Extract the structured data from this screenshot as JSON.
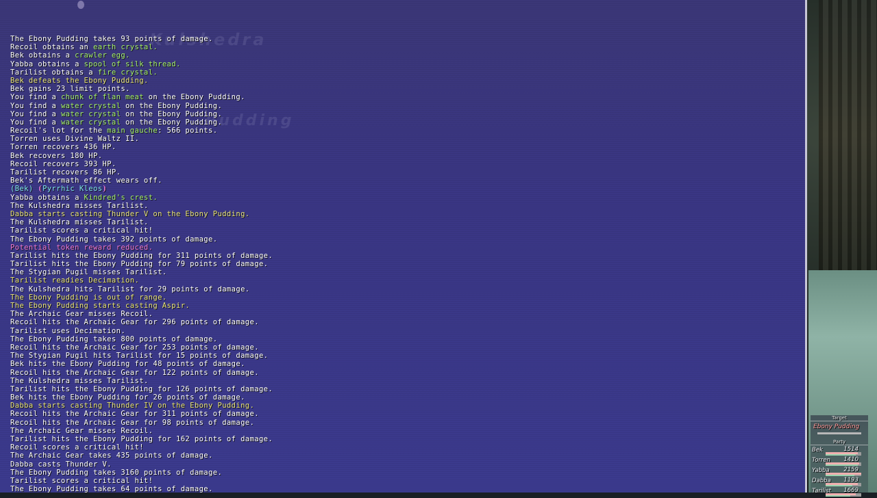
{
  "chat_log": {
    "lines": [
      {
        "segments": [
          {
            "t": "The Ebony Pudding takes 93 points of damage.",
            "c": "white"
          }
        ]
      },
      {
        "segments": [
          {
            "t": "Recoil obtains an ",
            "c": "white"
          },
          {
            "t": "earth crystal.",
            "c": "green"
          }
        ]
      },
      {
        "segments": [
          {
            "t": "Bek obtains a ",
            "c": "white"
          },
          {
            "t": "crawler egg.",
            "c": "green"
          }
        ]
      },
      {
        "segments": [
          {
            "t": "Yabba obtains a ",
            "c": "white"
          },
          {
            "t": "spool of silk thread.",
            "c": "green"
          }
        ]
      },
      {
        "segments": [
          {
            "t": "Tarilist obtains a ",
            "c": "white"
          },
          {
            "t": "fire crystal.",
            "c": "green"
          }
        ]
      },
      {
        "segments": [
          {
            "t": "Bek defeats the Ebony Pudding.",
            "c": "yellow"
          }
        ]
      },
      {
        "segments": [
          {
            "t": "Bek gains 23 limit points.",
            "c": "white"
          }
        ]
      },
      {
        "segments": [
          {
            "t": "You find a ",
            "c": "white"
          },
          {
            "t": "chunk of flan meat",
            "c": "green"
          },
          {
            "t": " on the Ebony Pudding.",
            "c": "white"
          }
        ]
      },
      {
        "segments": [
          {
            "t": "You find a ",
            "c": "white"
          },
          {
            "t": "water crystal",
            "c": "green"
          },
          {
            "t": " on the Ebony Pudding.",
            "c": "white"
          }
        ]
      },
      {
        "segments": [
          {
            "t": "You find a ",
            "c": "white"
          },
          {
            "t": "water crystal",
            "c": "green"
          },
          {
            "t": " on the Ebony Pudding.",
            "c": "white"
          }
        ]
      },
      {
        "segments": [
          {
            "t": "You find a ",
            "c": "white"
          },
          {
            "t": "water crystal",
            "c": "green"
          },
          {
            "t": " on the Ebony Pudding.",
            "c": "white"
          }
        ]
      },
      {
        "segments": [
          {
            "t": "Recoil's lot for the ",
            "c": "white"
          },
          {
            "t": "main gauche",
            "c": "green"
          },
          {
            "t": ": 566 points.",
            "c": "white"
          }
        ]
      },
      {
        "segments": [
          {
            "t": "Torren uses Divine Waltz II.",
            "c": "white"
          }
        ]
      },
      {
        "segments": [
          {
            "t": "Torren recovers 436 HP.",
            "c": "white"
          }
        ]
      },
      {
        "segments": [
          {
            "t": "Bek recovers 180 HP.",
            "c": "white"
          }
        ]
      },
      {
        "segments": [
          {
            "t": "Recoil recovers 393 HP.",
            "c": "white"
          }
        ]
      },
      {
        "segments": [
          {
            "t": "Tarilist recovers 86 HP.",
            "c": "white"
          }
        ]
      },
      {
        "segments": [
          {
            "t": "Bek's Aftermath effect wears off.",
            "c": "white"
          }
        ]
      },
      {
        "segments": [
          {
            "t": "(Bek) ",
            "c": "cyan"
          },
          {
            "t": "⦗",
            "c": "pink"
          },
          {
            "t": "Pyrrhic Kleos",
            "c": "cyan"
          },
          {
            "t": "⦘",
            "c": "pink"
          }
        ]
      },
      {
        "segments": [
          {
            "t": "Yabba obtains a ",
            "c": "white"
          },
          {
            "t": "Kindred's crest.",
            "c": "green"
          }
        ]
      },
      {
        "segments": [
          {
            "t": "The Kulshedra misses Tarilist.",
            "c": "white"
          }
        ]
      },
      {
        "segments": [
          {
            "t": "Dabba starts casting Thunder V on the Ebony Pudding.",
            "c": "yellow"
          }
        ]
      },
      {
        "segments": [
          {
            "t": "The Kulshedra misses Tarilist.",
            "c": "white"
          }
        ]
      },
      {
        "segments": [
          {
            "t": "Tarilist scores a critical hit!",
            "c": "white"
          }
        ]
      },
      {
        "segments": [
          {
            "t": "The Ebony Pudding takes 392 points of damage.",
            "c": "white"
          }
        ]
      },
      {
        "segments": [
          {
            "t": "Potential token reward reduced.",
            "c": "pink"
          }
        ]
      },
      {
        "segments": [
          {
            "t": "Tarilist hits the Ebony Pudding for 311 points of damage.",
            "c": "white"
          }
        ]
      },
      {
        "segments": [
          {
            "t": "Tarilist hits the Ebony Pudding for 79 points of damage.",
            "c": "white"
          }
        ]
      },
      {
        "segments": [
          {
            "t": "The Stygian Pugil misses Tarilist.",
            "c": "white"
          }
        ]
      },
      {
        "segments": [
          {
            "t": "Tarilist readies Decimation.",
            "c": "yellow"
          }
        ]
      },
      {
        "segments": [
          {
            "t": "The Kulshedra hits Tarilist for 29 points of damage.",
            "c": "white"
          }
        ]
      },
      {
        "segments": [
          {
            "t": "The Ebony Pudding is out of range.",
            "c": "yellow"
          }
        ]
      },
      {
        "segments": [
          {
            "t": "The Ebony Pudding starts casting Aspir.",
            "c": "yellow"
          }
        ]
      },
      {
        "segments": [
          {
            "t": "The Archaic Gear misses Recoil.",
            "c": "white"
          }
        ]
      },
      {
        "segments": [
          {
            "t": "Recoil hits the Archaic Gear for 296 points of damage.",
            "c": "white"
          }
        ]
      },
      {
        "segments": [
          {
            "t": "Tarilist uses Decimation.",
            "c": "white"
          }
        ]
      },
      {
        "segments": [
          {
            "t": "The Ebony Pudding takes 800 points of damage.",
            "c": "white"
          }
        ]
      },
      {
        "segments": [
          {
            "t": "Recoil hits the Archaic Gear for 253 points of damage.",
            "c": "white"
          }
        ]
      },
      {
        "segments": [
          {
            "t": "The Stygian Pugil hits Tarilist for 15 points of damage.",
            "c": "white"
          }
        ]
      },
      {
        "segments": [
          {
            "t": "Bek hits the Ebony Pudding for 48 points of damage.",
            "c": "white"
          }
        ]
      },
      {
        "segments": [
          {
            "t": "Recoil hits the Archaic Gear for 122 points of damage.",
            "c": "white"
          }
        ]
      },
      {
        "segments": [
          {
            "t": "The Kulshedra misses Tarilist.",
            "c": "white"
          }
        ]
      },
      {
        "segments": [
          {
            "t": "Tarilist hits the Ebony Pudding for 126 points of damage.",
            "c": "white"
          }
        ]
      },
      {
        "segments": [
          {
            "t": "Bek hits the Ebony Pudding for 26 points of damage.",
            "c": "white"
          }
        ]
      },
      {
        "segments": [
          {
            "t": "Dabba starts casting Thunder IV on the Ebony Pudding.",
            "c": "yellow"
          }
        ]
      },
      {
        "segments": [
          {
            "t": "Recoil hits the Archaic Gear for 311 points of damage.",
            "c": "white"
          }
        ]
      },
      {
        "segments": [
          {
            "t": "Recoil hits the Archaic Gear for 98 points of damage.",
            "c": "white"
          }
        ]
      },
      {
        "segments": [
          {
            "t": "The Archaic Gear misses Recoil.",
            "c": "white"
          }
        ]
      },
      {
        "segments": [
          {
            "t": "Tarilist hits the Ebony Pudding for 162 points of damage.",
            "c": "white"
          }
        ]
      },
      {
        "segments": [
          {
            "t": "Recoil scores a critical hit!",
            "c": "white"
          }
        ]
      },
      {
        "segments": [
          {
            "t": "The Archaic Gear takes 435 points of damage.",
            "c": "white"
          }
        ]
      },
      {
        "segments": [
          {
            "t": "Dabba casts Thunder V.",
            "c": "white"
          }
        ]
      },
      {
        "segments": [
          {
            "t": "The Ebony Pudding takes 3160 points of damage.",
            "c": "white"
          }
        ]
      },
      {
        "segments": [
          {
            "t": "Tarilist scores a critical hit!",
            "c": "white"
          }
        ]
      },
      {
        "segments": [
          {
            "t": "The Ebony Pudding takes 64 points of damage.",
            "c": "white"
          }
        ]
      }
    ],
    "background_text": [
      "Kulshedra",
      "Pudding"
    ]
  },
  "hud": {
    "target_label": "Target",
    "target_name": "Ebony Pudding",
    "party_label": "Party",
    "members": [
      {
        "name": "Bek",
        "hp": "1514",
        "hp_fraction": 0.9,
        "mp_fraction": 0.85
      },
      {
        "name": "Torren",
        "hp": "1410",
        "hp_fraction": 0.95,
        "mp_fraction": 0.9
      },
      {
        "name": "Yabba",
        "hp": "2159",
        "hp_fraction": 1.0,
        "mp_fraction": 0.8
      },
      {
        "name": "Dabba",
        "hp": "1193",
        "hp_fraction": 0.9,
        "mp_fraction": 0.75
      },
      {
        "name": "Tarilist",
        "hp": "1669",
        "hp_fraction": 0.85,
        "mp_fraction": 0.7
      }
    ]
  },
  "colors": {
    "white": "#ffffff",
    "yellow": "#e9e47c",
    "green": "#a6f16d",
    "cyan": "#7fe3ef",
    "pink": "#f07ad8"
  }
}
